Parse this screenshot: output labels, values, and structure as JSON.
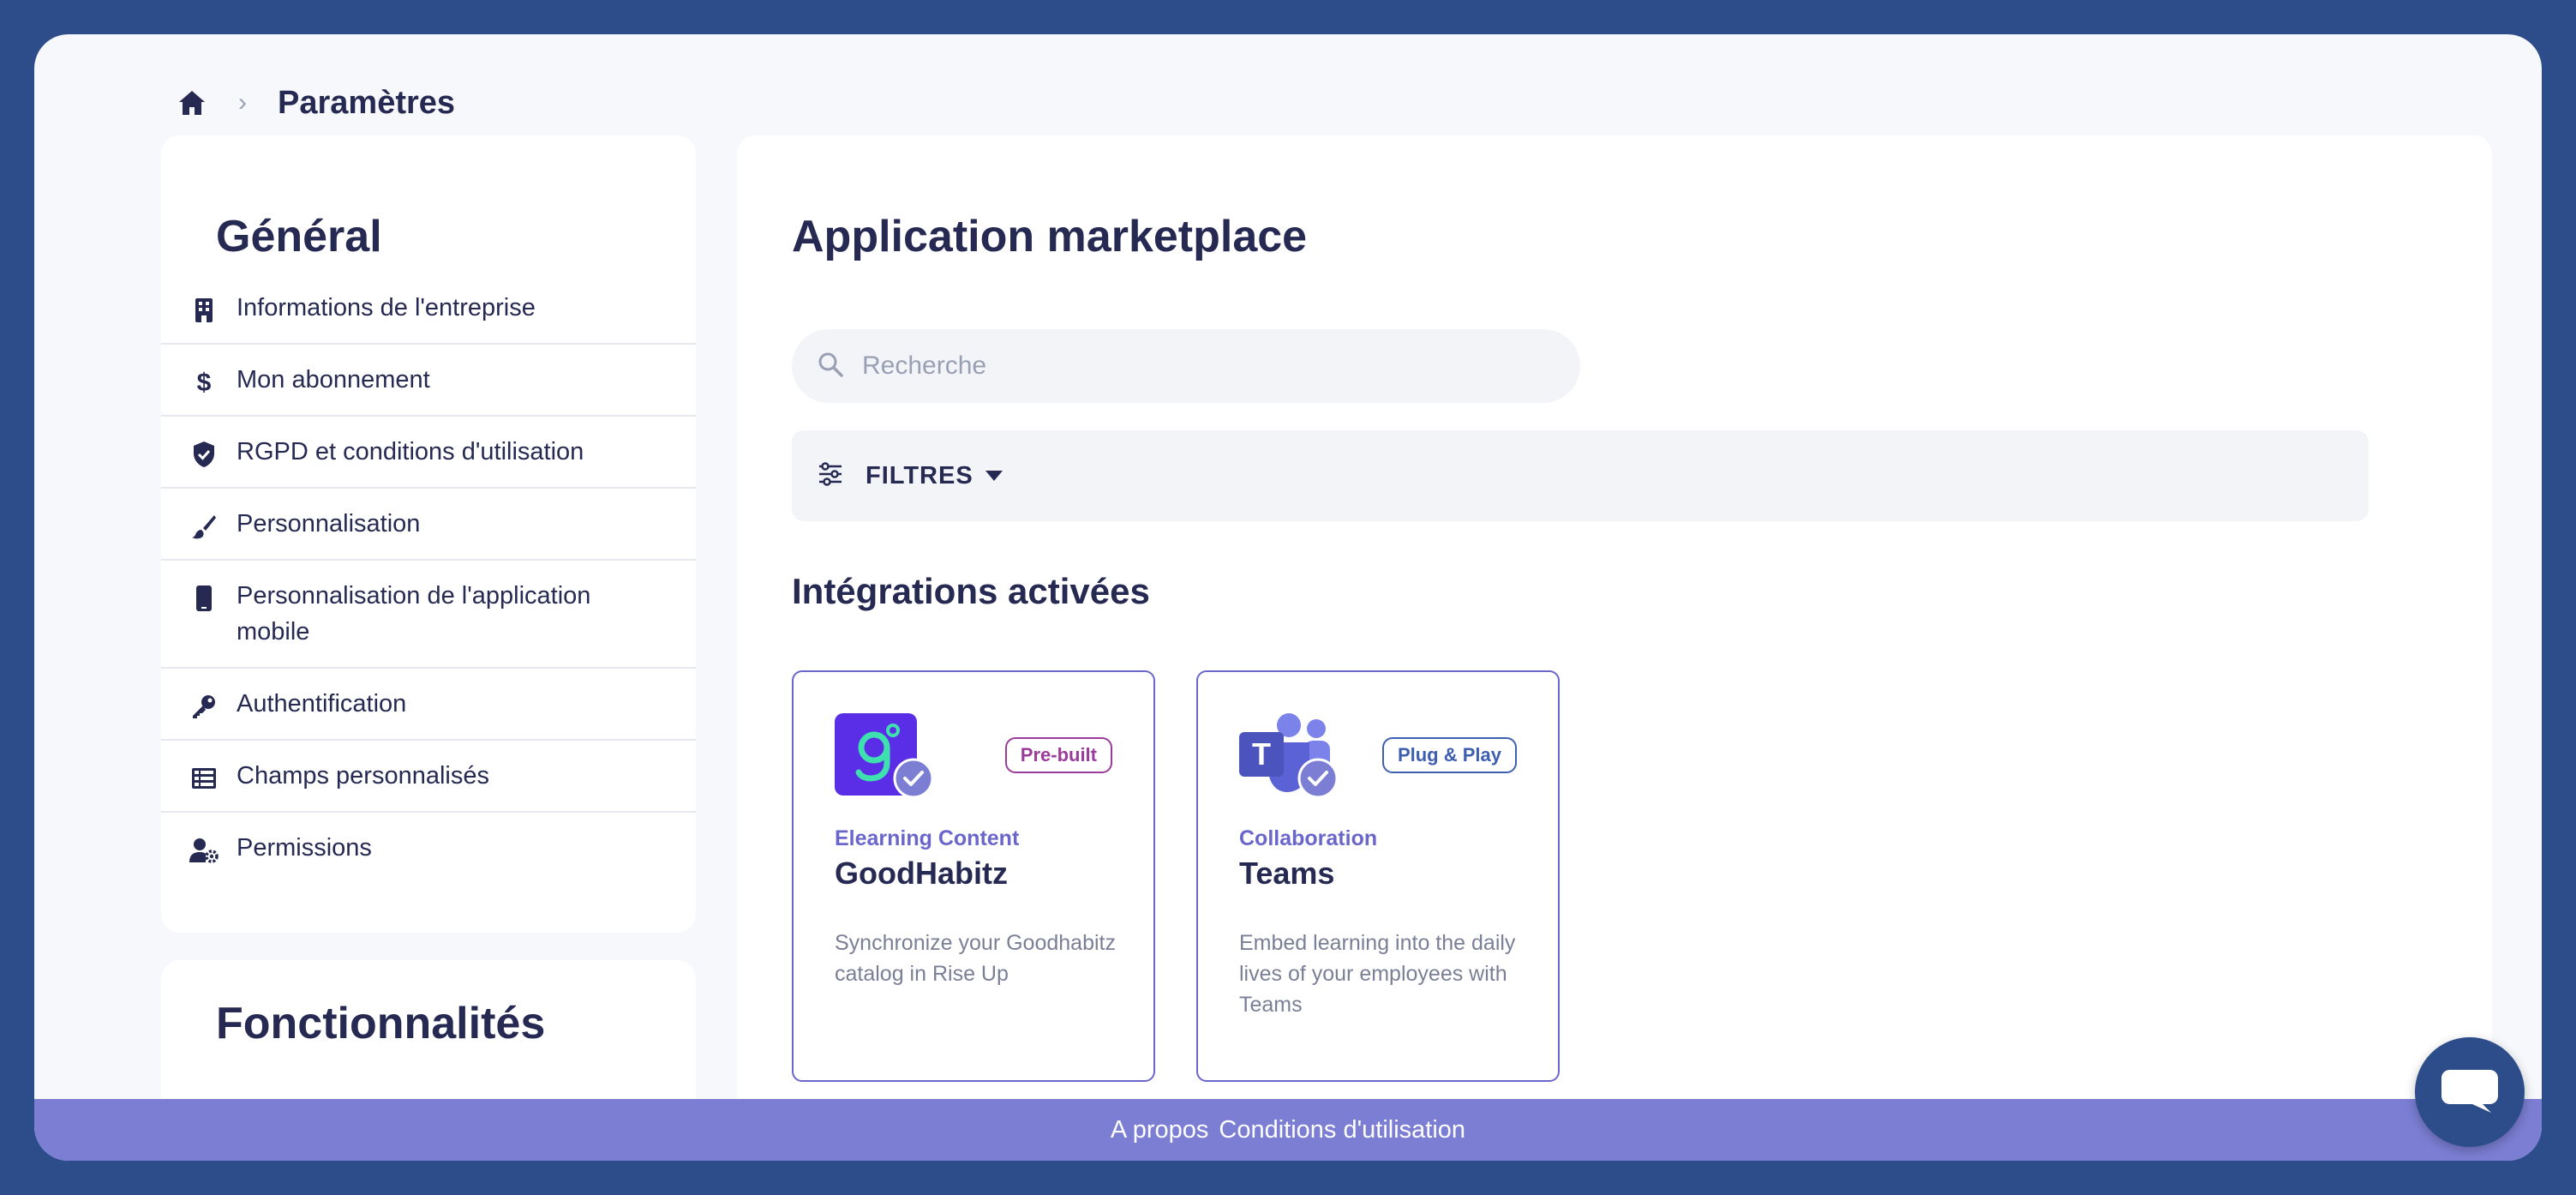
{
  "breadcrumb": {
    "home_icon": "home-icon",
    "separator": "›",
    "title": "Paramètres"
  },
  "sidebar": {
    "general_title": "Général",
    "items": [
      {
        "label": "Informations de l'entreprise",
        "icon": "building-icon"
      },
      {
        "label": "Mon abonnement",
        "icon": "dollar-icon"
      },
      {
        "label": "RGPD et conditions d'utilisation",
        "icon": "shield-check-icon"
      },
      {
        "label": "Personnalisation",
        "icon": "paintbrush-icon"
      },
      {
        "label": "Personnalisation de l'application mobile",
        "icon": "mobile-icon"
      },
      {
        "label": "Authentification",
        "icon": "key-icon"
      },
      {
        "label": "Champs personnalisés",
        "icon": "table-icon"
      },
      {
        "label": "Permissions",
        "icon": "user-gear-icon"
      }
    ],
    "features_title": "Fonctionnalités"
  },
  "main": {
    "title": "Application marketplace",
    "search": {
      "placeholder": "Recherche",
      "value": ""
    },
    "filters_label": "FILTRES",
    "section_title": "Intégrations activées",
    "cards": [
      {
        "badge": "Pre-built",
        "category": "Elearning Content",
        "name": "GoodHabitz",
        "description": "Synchronize your Goodhabitz catalog in Rise Up",
        "logo": "goodhabitz-logo"
      },
      {
        "badge": "Plug & Play",
        "category": "Collaboration",
        "name": "Teams",
        "description": "Embed learning into the daily lives of your employees with Teams",
        "logo": "teams-logo"
      }
    ]
  },
  "footer": {
    "about": "A propos",
    "terms": "Conditions d'utilisation"
  },
  "colors": {
    "background": "#2c4d8a",
    "accent": "#6a66cc",
    "footer": "#7b7ed3",
    "text": "#262a52"
  }
}
